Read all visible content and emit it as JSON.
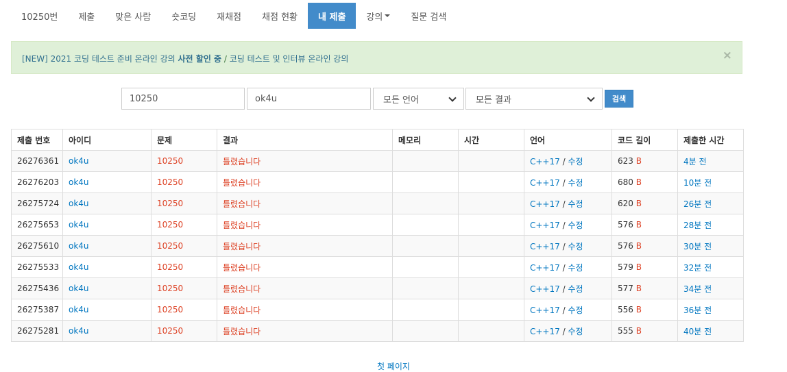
{
  "nav": {
    "items": [
      {
        "label": "10250번",
        "active": false
      },
      {
        "label": "제출",
        "active": false
      },
      {
        "label": "맞은 사람",
        "active": false
      },
      {
        "label": "숏코딩",
        "active": false
      },
      {
        "label": "재채점",
        "active": false
      },
      {
        "label": "채점 현황",
        "active": false
      },
      {
        "label": "내 제출",
        "active": true
      },
      {
        "label": "강의",
        "active": false
      },
      {
        "label": "질문 검색",
        "active": false
      }
    ]
  },
  "alert": {
    "prefix": "[NEW] 2021 코딩 테스트 준비 온라인 강의 ",
    "bold": "사전 할인 중",
    "separator": " / ",
    "link2": "코딩 테스트 및 인터뷰 온라인 강의",
    "close": "×"
  },
  "filter": {
    "problem_value": "10250",
    "user_value": "ok4u",
    "language_selected": "모든 언어",
    "result_selected": "모든 결과",
    "search_label": "검색"
  },
  "table": {
    "headers": [
      "제출 번호",
      "아이디",
      "문제",
      "결과",
      "메모리",
      "시간",
      "언어",
      "코드 길이",
      "제출한 시간"
    ],
    "rows": [
      {
        "id": "26276361",
        "user": "ok4u",
        "problem": "10250",
        "result": "틀렸습니다",
        "memory": "",
        "time": "",
        "lang": "C++17",
        "edit": "수정",
        "len": "623",
        "unit": "B",
        "submitted": "4분 전"
      },
      {
        "id": "26276203",
        "user": "ok4u",
        "problem": "10250",
        "result": "틀렸습니다",
        "memory": "",
        "time": "",
        "lang": "C++17",
        "edit": "수정",
        "len": "680",
        "unit": "B",
        "submitted": "10분 전"
      },
      {
        "id": "26275724",
        "user": "ok4u",
        "problem": "10250",
        "result": "틀렸습니다",
        "memory": "",
        "time": "",
        "lang": "C++17",
        "edit": "수정",
        "len": "620",
        "unit": "B",
        "submitted": "26분 전"
      },
      {
        "id": "26275653",
        "user": "ok4u",
        "problem": "10250",
        "result": "틀렸습니다",
        "memory": "",
        "time": "",
        "lang": "C++17",
        "edit": "수정",
        "len": "576",
        "unit": "B",
        "submitted": "28분 전"
      },
      {
        "id": "26275610",
        "user": "ok4u",
        "problem": "10250",
        "result": "틀렸습니다",
        "memory": "",
        "time": "",
        "lang": "C++17",
        "edit": "수정",
        "len": "576",
        "unit": "B",
        "submitted": "30분 전"
      },
      {
        "id": "26275533",
        "user": "ok4u",
        "problem": "10250",
        "result": "틀렸습니다",
        "memory": "",
        "time": "",
        "lang": "C++17",
        "edit": "수정",
        "len": "579",
        "unit": "B",
        "submitted": "32분 전"
      },
      {
        "id": "26275436",
        "user": "ok4u",
        "problem": "10250",
        "result": "틀렸습니다",
        "memory": "",
        "time": "",
        "lang": "C++17",
        "edit": "수정",
        "len": "577",
        "unit": "B",
        "submitted": "34분 전"
      },
      {
        "id": "26275387",
        "user": "ok4u",
        "problem": "10250",
        "result": "틀렸습니다",
        "memory": "",
        "time": "",
        "lang": "C++17",
        "edit": "수정",
        "len": "556",
        "unit": "B",
        "submitted": "36분 전"
      },
      {
        "id": "26275281",
        "user": "ok4u",
        "problem": "10250",
        "result": "틀렸습니다",
        "memory": "",
        "time": "",
        "lang": "C++17",
        "edit": "수정",
        "len": "555",
        "unit": "B",
        "submitted": "40분 전"
      }
    ]
  },
  "pager": {
    "first_page": "첫 페이지"
  },
  "colors": {
    "accent": "#428bca",
    "link": "#0076c0",
    "error": "#dd4124",
    "alert_bg": "#dff0d8"
  }
}
